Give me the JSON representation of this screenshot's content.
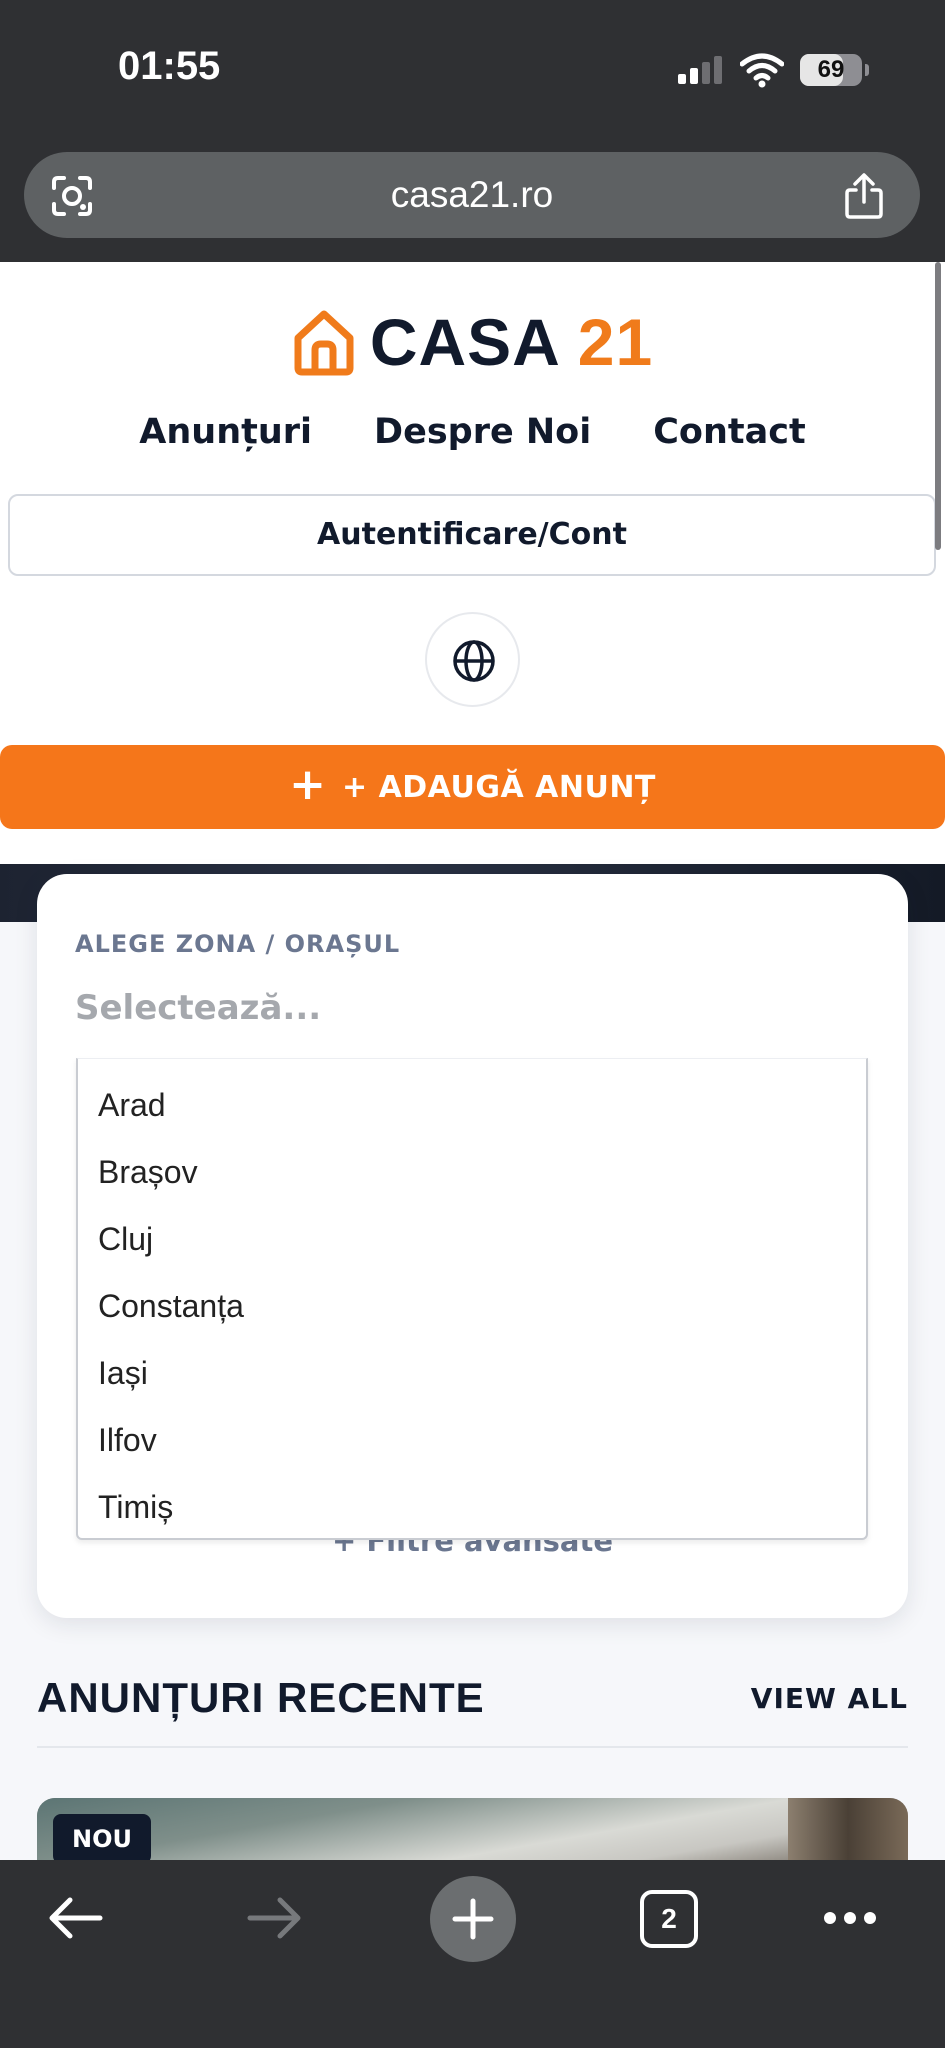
{
  "status_bar": {
    "time": "01:55",
    "battery": "69",
    "battery_level": 0.69
  },
  "browser": {
    "url": "casa21.ro",
    "open_tabs": "2"
  },
  "site": {
    "logo_word": "CASA",
    "logo_number": "21",
    "nav": [
      "Anunțuri",
      "Despre Noi",
      "Contact"
    ],
    "auth_label": "Autentificare/Cont",
    "add_listing_plus": "+",
    "add_listing_label": "+ ADAUGĂ ANUNȚ"
  },
  "search": {
    "zone_label": "ALEGE ZONA / ORAȘUL",
    "select_placeholder": "Selectează...",
    "options": [
      "Arad",
      "Brașov",
      "Cluj",
      "Constanța",
      "Iași",
      "Ilfov",
      "Timiș"
    ],
    "advanced_filters": "+ Filtre avansate"
  },
  "recent": {
    "title": "ANUNȚURI RECENTE",
    "view_all": "VIEW ALL",
    "first_badge": "NOU"
  },
  "colors": {
    "accent": "#f5761a",
    "navy": "#111a2c",
    "muted": "#6b7790",
    "chrome": "#2f3033"
  }
}
